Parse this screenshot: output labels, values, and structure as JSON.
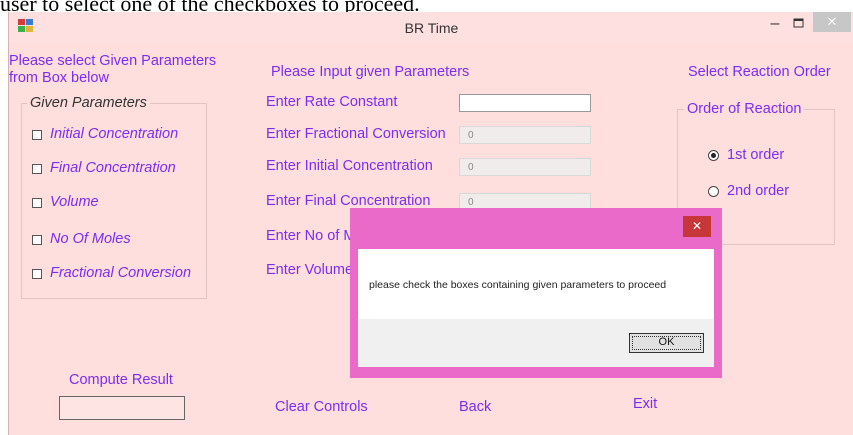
{
  "overflow_caption": "user to select one of the checkboxes to proceed.",
  "window": {
    "title": "BR Time",
    "min_glyph": "–",
    "close_glyph": "✕"
  },
  "left": {
    "instruction": "Please select Given Parameters\nfrom Box below",
    "group_title": "Given Parameters",
    "options": [
      "Initial Concentration",
      "Final Concentration",
      "Volume",
      "No Of Moles",
      "Fractional Conversion"
    ],
    "compute_label": "Compute Result",
    "result_value": ""
  },
  "middle": {
    "heading": "Please Input given Parameters",
    "fields": [
      {
        "label": "Enter Rate Constant",
        "value": "",
        "enabled": true
      },
      {
        "label": "Enter Fractional Conversion",
        "value": "0",
        "enabled": false
      },
      {
        "label": "Enter Initial Concentration",
        "value": "0",
        "enabled": false
      },
      {
        "label": "Enter Final Concentration",
        "value": "0",
        "enabled": false
      },
      {
        "label": "Enter No of Mo",
        "value": "",
        "enabled": false
      },
      {
        "label": "Enter Volume",
        "value": "",
        "enabled": false
      }
    ]
  },
  "right": {
    "heading": "Select Reaction Order",
    "group_title": "Order of Reaction",
    "orders": [
      {
        "label": "1st order",
        "selected": true
      },
      {
        "label": "2nd order",
        "selected": false
      }
    ]
  },
  "footer": {
    "clear": "Clear Controls",
    "back": "Back",
    "exit": "Exit"
  },
  "dialog": {
    "close_glyph": "✕",
    "message": "please check the boxes containing given parameters to proceed",
    "ok": "OK"
  },
  "colors": {
    "window_bg": "#ffdede",
    "label": "#7d2df0",
    "dialog_frame": "#e96ac8",
    "dialog_close": "#c7373a"
  }
}
